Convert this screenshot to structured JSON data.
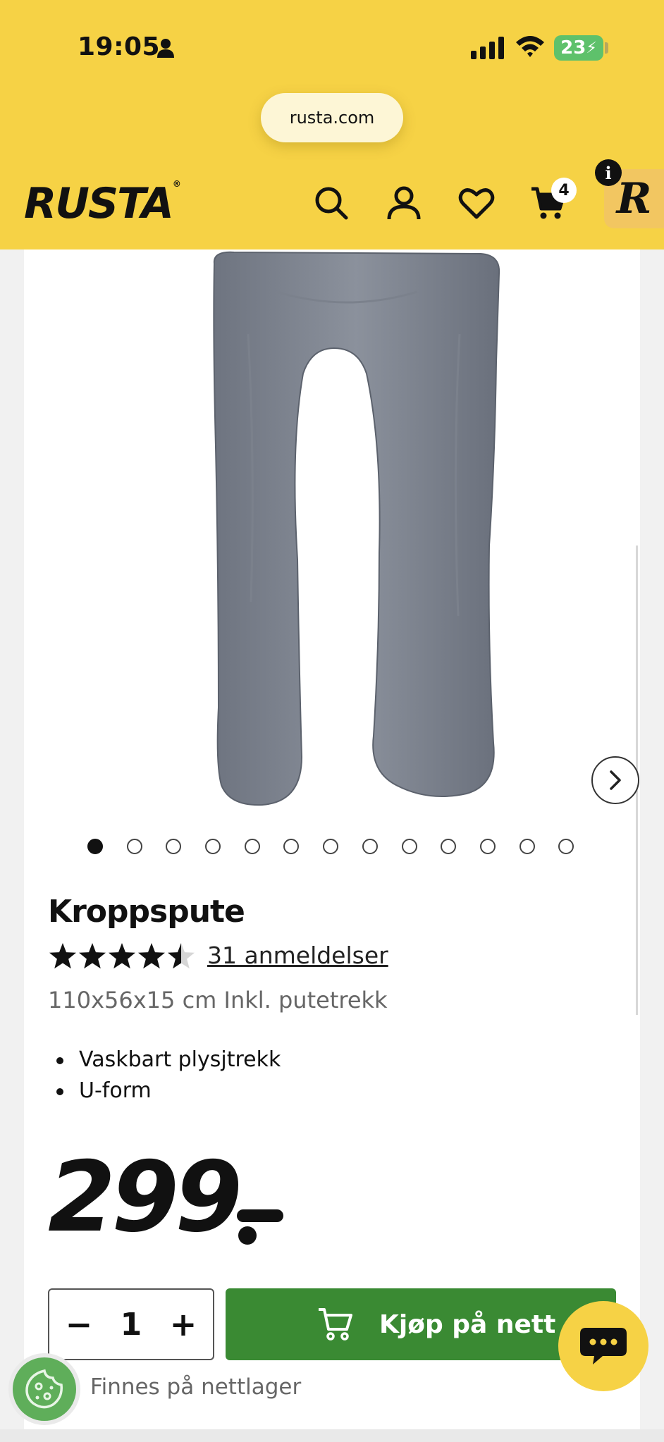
{
  "status_bar": {
    "time": "19:05",
    "battery": "23"
  },
  "browser": {
    "url": "rusta.com"
  },
  "header": {
    "logo_text": "RUSTA",
    "logo_mark": "®",
    "icons": [
      "search-icon",
      "account-icon",
      "heart-icon",
      "cart-icon"
    ],
    "cart_count": "4",
    "info_badge": "i",
    "r_badge": "R"
  },
  "product": {
    "image_count": 13,
    "active_image_index": 0,
    "title": "Kroppspute",
    "rating": 4.5,
    "rating_max": 5,
    "reviews_label": "31 anmeldelser",
    "subtitle": "110x56x15 cm Inkl. putetrekk",
    "features": [
      "Vaskbart plysjtrekk",
      "U-form"
    ],
    "price": "299",
    "quantity": "1",
    "buy_label": "Kjøp på nett",
    "stock_status": "Finnes på nettlager"
  },
  "colors": {
    "brand_yellow": "#f6d245",
    "buy_green": "#3a8a33",
    "cookie_green": "#5fae5a"
  }
}
